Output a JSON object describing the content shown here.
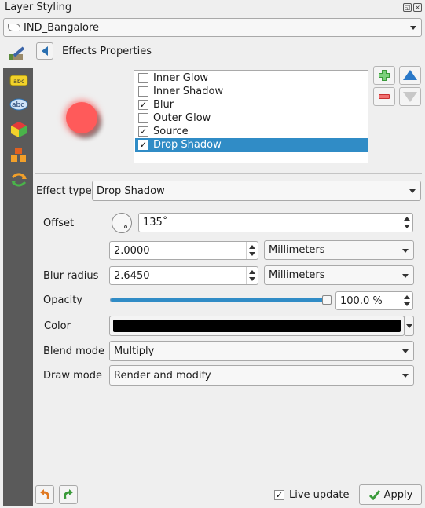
{
  "window": {
    "title": "Layer Styling"
  },
  "layer_selector": {
    "value": "IND_Bangalore"
  },
  "panel": {
    "title": "Effects Properties"
  },
  "effects": [
    {
      "label": "Inner Glow",
      "checked": false,
      "selected": false
    },
    {
      "label": "Inner Shadow",
      "checked": false,
      "selected": false
    },
    {
      "label": "Blur",
      "checked": true,
      "selected": false
    },
    {
      "label": "Outer Glow",
      "checked": false,
      "selected": false
    },
    {
      "label": "Source",
      "checked": true,
      "selected": false
    },
    {
      "label": "Drop Shadow",
      "checked": true,
      "selected": true
    }
  ],
  "check_glyph": "✓",
  "effect_type": {
    "label": "Effect type",
    "value": "Drop Shadow"
  },
  "offset": {
    "label": "Offset",
    "angle": "135˚",
    "distance": "2.0000",
    "unit": "Millimeters"
  },
  "blur_radius": {
    "label": "Blur radius",
    "value": "2.6450",
    "unit": "Millimeters"
  },
  "opacity": {
    "label": "Opacity",
    "value": "100.0 %",
    "level": 1.0
  },
  "color": {
    "label": "Color",
    "value": "#000000"
  },
  "blend_mode": {
    "label": "Blend mode",
    "value": "Multiply"
  },
  "draw_mode": {
    "label": "Draw mode",
    "value": "Render and modify"
  },
  "footer": {
    "live_update_label": "Live update",
    "live_update_checked": true,
    "apply_label": "Apply"
  },
  "colors": {
    "accent": "#308cc6",
    "preview_fill": "#ff5a5a"
  }
}
